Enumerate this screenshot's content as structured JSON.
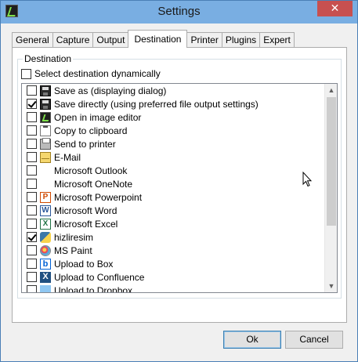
{
  "window": {
    "title": "Settings",
    "close_glyph": "✕"
  },
  "tabs": [
    {
      "label": "General",
      "active": false
    },
    {
      "label": "Capture",
      "active": false
    },
    {
      "label": "Output",
      "active": false
    },
    {
      "label": "Destination",
      "active": true
    },
    {
      "label": "Printer",
      "active": false
    },
    {
      "label": "Plugins",
      "active": false
    },
    {
      "label": "Expert",
      "active": false
    }
  ],
  "destination": {
    "group_label": "Destination",
    "dynamic_label": "Select destination dynamically",
    "dynamic_checked": false,
    "items": [
      {
        "label": "Save as (displaying dialog)",
        "checked": false,
        "icon": "save-icon"
      },
      {
        "label": "Save directly (using preferred file output settings)",
        "checked": true,
        "icon": "save-icon"
      },
      {
        "label": "Open in image editor",
        "checked": false,
        "icon": "image-editor-icon"
      },
      {
        "label": "Copy to clipboard",
        "checked": false,
        "icon": "clipboard-icon"
      },
      {
        "label": "Send to printer",
        "checked": false,
        "icon": "printer-icon"
      },
      {
        "label": "E-Mail",
        "checked": false,
        "icon": "mail-icon"
      },
      {
        "label": "Microsoft Outlook",
        "checked": false,
        "icon": ""
      },
      {
        "label": "Microsoft OneNote",
        "checked": false,
        "icon": ""
      },
      {
        "label": "Microsoft Powerpoint",
        "checked": false,
        "icon": "powerpoint-icon"
      },
      {
        "label": "Microsoft Word",
        "checked": false,
        "icon": "word-icon"
      },
      {
        "label": "Microsoft Excel",
        "checked": false,
        "icon": "excel-icon"
      },
      {
        "label": "hizliresim",
        "checked": true,
        "icon": "python-icon"
      },
      {
        "label": "MS Paint",
        "checked": false,
        "icon": "paint-icon"
      },
      {
        "label": "Upload to Box",
        "checked": false,
        "icon": "box-icon"
      },
      {
        "label": "Upload to Confluence",
        "checked": false,
        "icon": "confluence-icon"
      },
      {
        "label": "Upload to Dropbox",
        "checked": false,
        "icon": "dropbox-icon"
      }
    ]
  },
  "buttons": {
    "ok": "Ok",
    "cancel": "Cancel"
  }
}
